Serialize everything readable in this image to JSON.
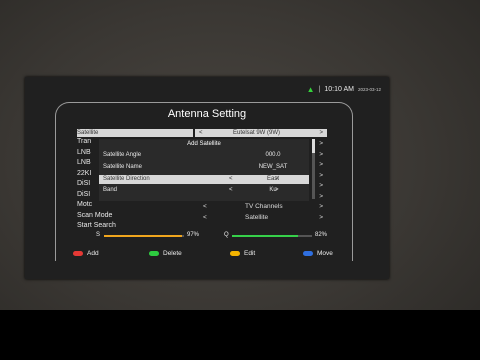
{
  "header": {
    "time": "10:10 AM",
    "date": "2023-03-12",
    "title": "Antenna Setting"
  },
  "menu": {
    "items": [
      "Satellite",
      "Tran",
      "LNB",
      "LNB",
      "22KI",
      "DiSI",
      "DiSI",
      "Motc",
      "Scan Mode",
      "Start Search"
    ]
  },
  "satellite": {
    "left": "<",
    "value": "Eutelsat 9W (9W)",
    "right": ">"
  },
  "right_values": [
    {
      "lt": "",
      "v": "",
      "gt": ">"
    },
    {
      "lt": "",
      "v": "",
      "gt": ">"
    },
    {
      "lt": "",
      "v": "",
      "gt": ">"
    },
    {
      "lt": "",
      "v": "",
      "gt": ">"
    },
    {
      "lt": "",
      "v": "",
      "gt": ">"
    },
    {
      "lt": "",
      "v": "",
      "gt": ">"
    },
    {
      "lt": "<",
      "v": "TV Channels",
      "gt": ">"
    },
    {
      "lt": "<",
      "v": "Satellite",
      "gt": ">"
    }
  ],
  "dialog": {
    "title": "Add Satellite",
    "rows": [
      {
        "label": "Satellite Angle",
        "lt": "",
        "value": "000.0",
        "gt": ""
      },
      {
        "label": "Satellite Name",
        "lt": "",
        "value": "NEW_SAT",
        "gt": ""
      },
      {
        "label": "Satellite Direction",
        "lt": "<",
        "value": "East",
        "gt": ">"
      },
      {
        "label": "Band",
        "lt": "<",
        "value": "Ku",
        "gt": ">"
      }
    ]
  },
  "signal": {
    "s_label": "S",
    "s_pct_text": "97%",
    "s_value": 0.97,
    "q_label": "Q",
    "q_pct_text": "82%",
    "q_value": 0.82,
    "s_color": "#f0a61e",
    "q_color": "#36d14a"
  },
  "legend": [
    {
      "label": "Add",
      "color": "#e53935"
    },
    {
      "label": "Delete",
      "color": "#2ecc40"
    },
    {
      "label": "Edit",
      "color": "#f4b400"
    },
    {
      "label": "Move",
      "color": "#2f6fe0"
    }
  ]
}
